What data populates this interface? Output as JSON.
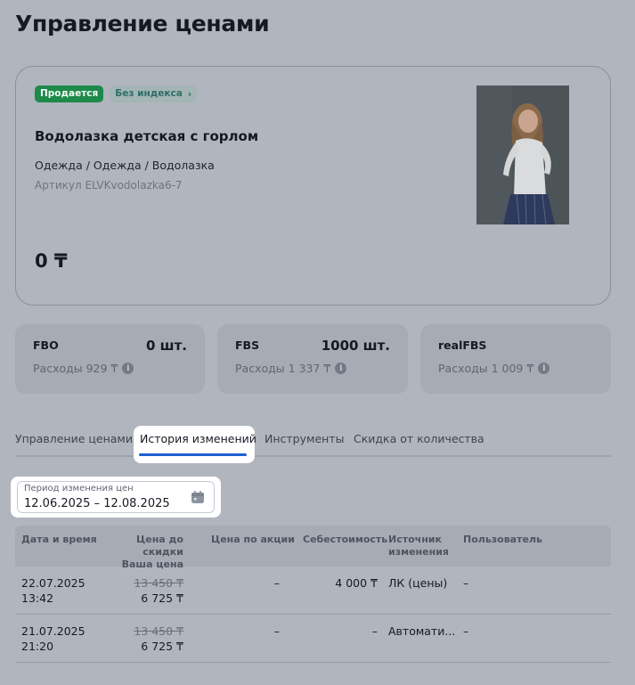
{
  "page": {
    "title": "Управление ценами"
  },
  "product": {
    "status_badge": "Продается",
    "index_badge": "Без индекса",
    "name": "Водолазка детская с горлом",
    "category": "Одежда / Одежда / Водолазка",
    "sku": "Артикул ELVKvodolazka6-7",
    "price": "0 ₸"
  },
  "stocks": [
    {
      "name": "FBO",
      "qty": "0 шт.",
      "cost": "Расходы 929 ₸"
    },
    {
      "name": "FBS",
      "qty": "1000 шт.",
      "cost": "Расходы 1 337 ₸"
    },
    {
      "name": "realFBS",
      "qty": "",
      "cost": "Расходы 1 009 ₸"
    }
  ],
  "tabs": [
    {
      "label": "Управление ценами"
    },
    {
      "label": "История изменений",
      "active": true
    },
    {
      "label": "Инструменты"
    },
    {
      "label": "Скидка от количества"
    }
  ],
  "date_filter": {
    "label": "Период изменения цен",
    "value": "12.06.2025 – 12.08.2025"
  },
  "table": {
    "headers": {
      "datetime": "Дата и время",
      "price_before_l1": "Цена до скидки",
      "price_before_l2": "Ваша цена",
      "promo_price": "Цена по акции",
      "cost": "Себестоимость",
      "source_l1": "Источник",
      "source_l2": "изменения",
      "user": "Пользователь"
    },
    "rows": [
      {
        "date": "22.07.2025",
        "time": "13:42",
        "old_price": "13 450 ₸",
        "new_price": "6 725 ₸",
        "promo_price": "–",
        "cost": "4 000 ₸",
        "source": "ЛК (цены)",
        "user": "–"
      },
      {
        "date": "21.07.2025",
        "time": "21:20",
        "old_price": "13 450 ₸",
        "new_price": "6 725 ₸",
        "promo_price": "–",
        "cost": "–",
        "source": "Автомати...",
        "user": "–"
      }
    ]
  },
  "colors": {
    "overlay_bg": "#b1b5bd",
    "selling_badge": "#1d8a49",
    "active_tab_underline": "#1f5fd1"
  },
  "icons": [
    "chevron-right-icon",
    "info-icon",
    "calendar-icon"
  ]
}
